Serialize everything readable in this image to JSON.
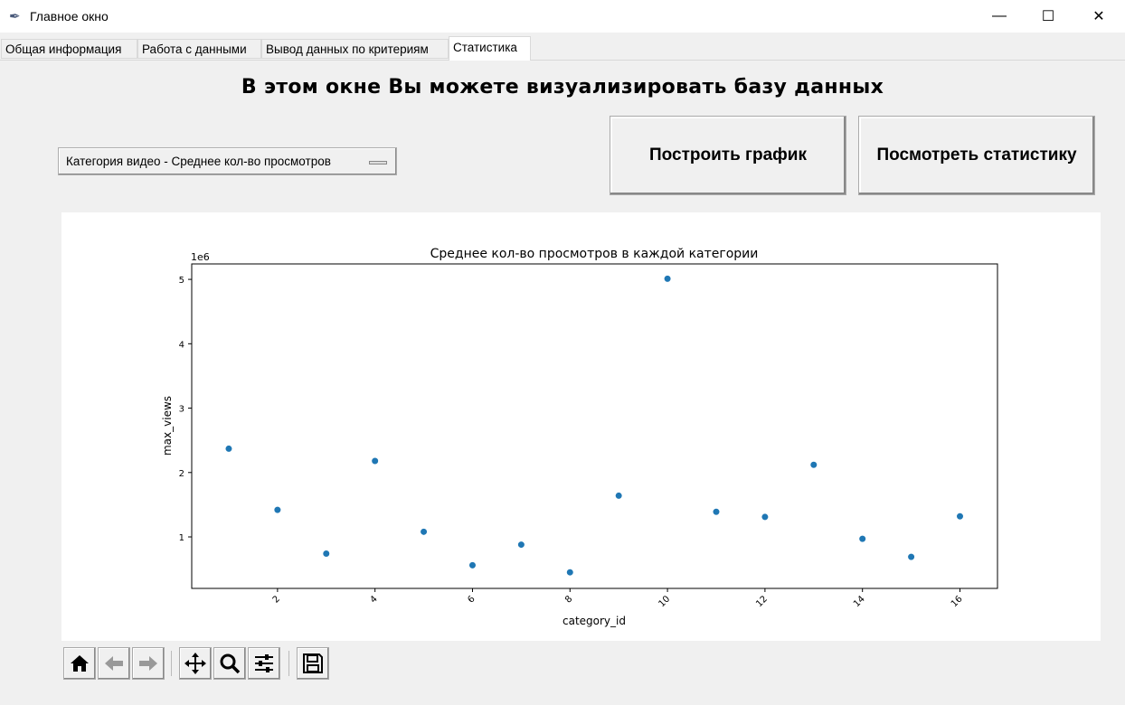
{
  "window": {
    "title": "Главное окно",
    "app_icon": "feather-icon",
    "controls": [
      "minimize-icon",
      "maximize-icon",
      "close-icon"
    ]
  },
  "tabs": [
    {
      "label": "Общая информация",
      "active": false
    },
    {
      "label": "Работа с данными",
      "active": false
    },
    {
      "label": "Вывод данных по критериям",
      "active": false
    },
    {
      "label": "Статистика",
      "active": true
    }
  ],
  "main": {
    "heading": "В этом окне Вы можете визуализировать базу данных",
    "select_value": "Категория видео - Среднее кол-во просмотров",
    "build_button": "Построить график",
    "stats_button": "Посмотреть статистику"
  },
  "toolbar": [
    "home-icon",
    "back-icon",
    "forward-icon",
    "pan-icon",
    "zoom-icon",
    "configure-subplots-icon",
    "save-icon"
  ],
  "chart_data": {
    "type": "scatter",
    "title": "Среднее кол-во просмотров в каждой категории",
    "xlabel": "category_id",
    "ylabel": "max_views",
    "y_offset_label": "1e6",
    "x": [
      1,
      2,
      3,
      4,
      5,
      6,
      7,
      8,
      9,
      10,
      11,
      12,
      13,
      14,
      15,
      16
    ],
    "y": [
      2370000,
      1420000,
      740000,
      2180000,
      1080000,
      560000,
      880000,
      450000,
      1640000,
      5010000,
      1390000,
      1310000,
      2120000,
      970000,
      690000,
      1320000
    ],
    "xlim": [
      0.24,
      16.77
    ],
    "ylim": [
      200000,
      5240000
    ],
    "xticks": [
      "2",
      "4",
      "6",
      "8",
      "10",
      "12",
      "14",
      "16"
    ],
    "yticks": [
      "1",
      "2",
      "3",
      "4",
      "5"
    ],
    "grid": false,
    "color": "#1f77b4"
  }
}
